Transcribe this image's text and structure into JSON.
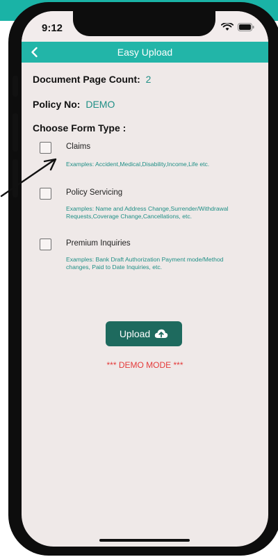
{
  "status_bar": {
    "time": "9:12"
  },
  "nav": {
    "title": "Easy Upload",
    "back_icon": "chevron-left-icon"
  },
  "document": {
    "page_count_label": "Document Page Count:",
    "page_count_value": "2",
    "policy_label": "Policy No:",
    "policy_value": "DEMO"
  },
  "form_type": {
    "heading": "Choose Form Type :",
    "options": [
      {
        "label": "Claims",
        "examples": "Examples: Accident,Medical,Disability,Income,Life etc.",
        "checked": false
      },
      {
        "label": "Policy Servicing",
        "examples": "Examples: Name and Address Change,Surrender/Withdrawal Requests,Coverage Change,Cancellations, etc.",
        "checked": false
      },
      {
        "label": "Premium Inquiries",
        "examples": "Examples: Bank Draft Authorization Payment mode/Method changes, Paid to Date Inquiries, etc.",
        "checked": false
      }
    ]
  },
  "actions": {
    "upload_label": "Upload",
    "upload_icon": "cloud-upload-icon"
  },
  "footer": {
    "demo_mode": "*** DEMO MODE ***"
  },
  "colors": {
    "accent": "#22b5a8",
    "button": "#1e6a5e",
    "value_text": "#1f8f86",
    "warning": "#e43a3a",
    "background": "#efe9e8"
  }
}
